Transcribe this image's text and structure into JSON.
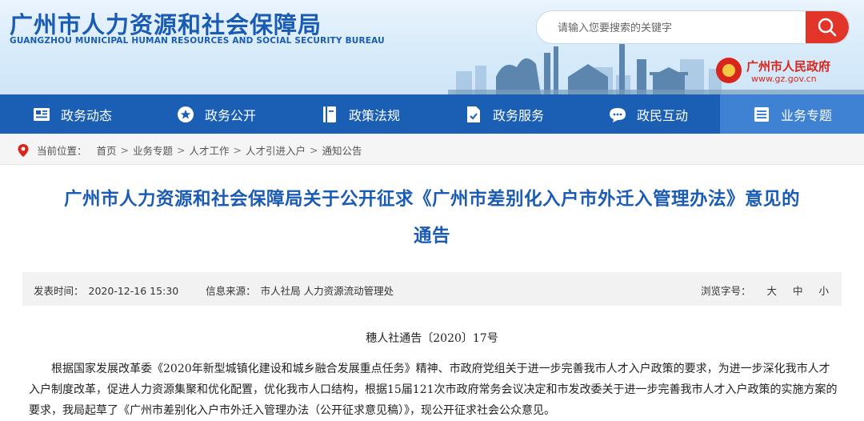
{
  "header": {
    "title": "广州市人力资源和社会保障局",
    "subtitle": "GUANGZHOU MUNICIPAL HUMAN RESOURCES AND SOCIAL SECURITY BUREAU",
    "search_placeholder": "请输入您要搜索的关键字",
    "search_icon": "search-icon",
    "gov_logo_name": "广州市人民政府",
    "gov_logo_url": "www.gz.gov.cn"
  },
  "nav": {
    "items": [
      {
        "label": "政务动态",
        "icon": "newspaper-icon"
      },
      {
        "label": "政务公开",
        "icon": "star-circle-icon"
      },
      {
        "label": "政策法规",
        "icon": "book-icon"
      },
      {
        "label": "政务服务",
        "icon": "document-check-icon"
      },
      {
        "label": "政民互动",
        "icon": "chat-bubble-icon"
      },
      {
        "label": "业务专题",
        "icon": "list-icon",
        "active": true
      }
    ]
  },
  "breadcrumb": {
    "prefix": "当前位置：",
    "items": [
      "首页",
      "业务专题",
      "人才工作",
      "人才引进入户",
      "通知公告"
    ],
    "separator": ">"
  },
  "article": {
    "title_line1": "广州市人力资源和社会保障局关于公开征求《广州市差别化入户市外迁入管理办法》意见的",
    "title_line2": "通告",
    "meta": {
      "date_label": "发表时间：",
      "date": "2020-12-16 15:30",
      "source_label": "信息来源：",
      "source": "市人社局 人力资源流动管理处",
      "font_size_label": "浏览字号：",
      "font_sizes": [
        "大",
        "中",
        "小"
      ]
    },
    "doc_number": "穗人社通告〔2020〕17号",
    "body": "根据国家发展改革委《2020年新型城镇化建设和城乡融合发展重点任务》精神、市政府党组关于进一步完善我市人才入户政策的要求，为进一步深化我市人才入户制度改革，促进人力资源集聚和优化配置，优化我市人口结构，根据15届121次市政府常务会议决定和市发改委关于进一步完善我市人才入户政策的实施方案的要求，我局起草了《广州市差别化入户市外迁入管理办法（公开征求意见稿）》，现公开征求社会公众意见。"
  },
  "colors": {
    "brand_blue": "#1a5bb3",
    "nav_blue": "#1a5fb4",
    "nav_active": "#3f82d4",
    "search_red": "#e2352a",
    "gov_red": "#d8261c"
  }
}
